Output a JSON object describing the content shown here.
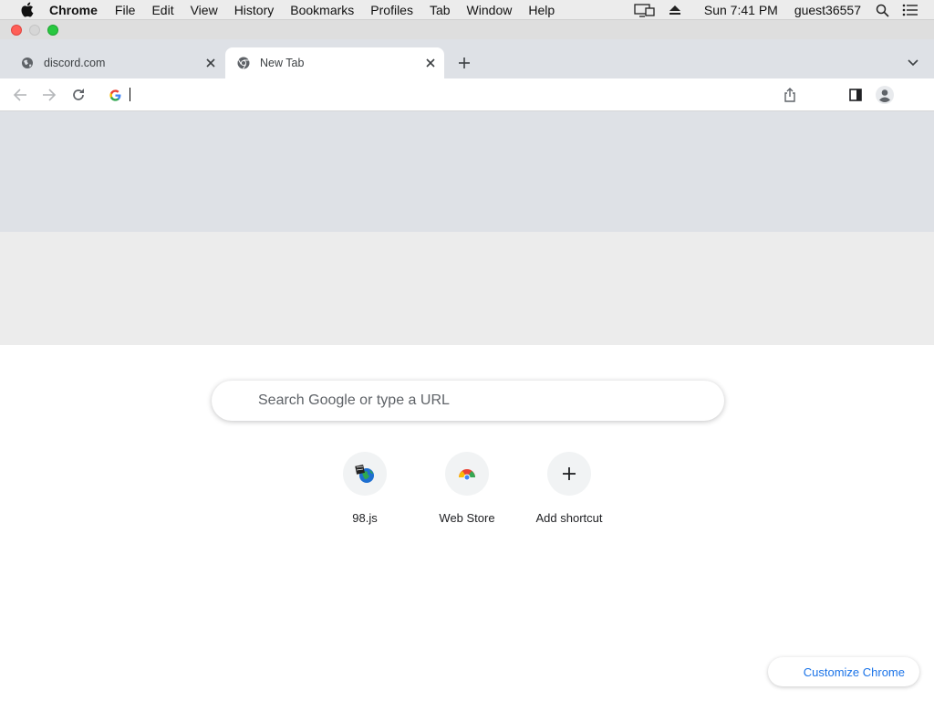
{
  "menubar": {
    "app_name": "Chrome",
    "items": [
      "File",
      "Edit",
      "View",
      "History",
      "Bookmarks",
      "Profiles",
      "Tab",
      "Window",
      "Help"
    ],
    "clock": "Sun 7:41 PM",
    "user": "guest36557",
    "icons": [
      "apple-icon",
      "display-icon",
      "eject-icon",
      "spotlight-search-icon",
      "notification-list-icon"
    ]
  },
  "tabs": [
    {
      "title": "discord.com",
      "active": false,
      "favicon": "globe-icon"
    },
    {
      "title": "New Tab",
      "active": true,
      "favicon": "chrome-icon"
    }
  ],
  "toolbar": {
    "omnibox_value": "",
    "icons": [
      "back-icon",
      "forward-icon",
      "reload-icon",
      "google-g-icon",
      "share-icon",
      "side-panel-icon",
      "profile-icon"
    ]
  },
  "ntp": {
    "search_placeholder": "Search Google or type a URL",
    "shortcuts": [
      {
        "label": "98.js",
        "icon": "globe-icon"
      },
      {
        "label": "Web Store",
        "icon": "webstore-icon"
      },
      {
        "label": "Add shortcut",
        "icon": "plus-icon"
      }
    ],
    "customize_label": "Customize Chrome"
  },
  "colors": {
    "accent": "#1a73e8",
    "tabstrip": "#dee1e6",
    "close_red": "#ff5f57",
    "max_green": "#28c840"
  }
}
